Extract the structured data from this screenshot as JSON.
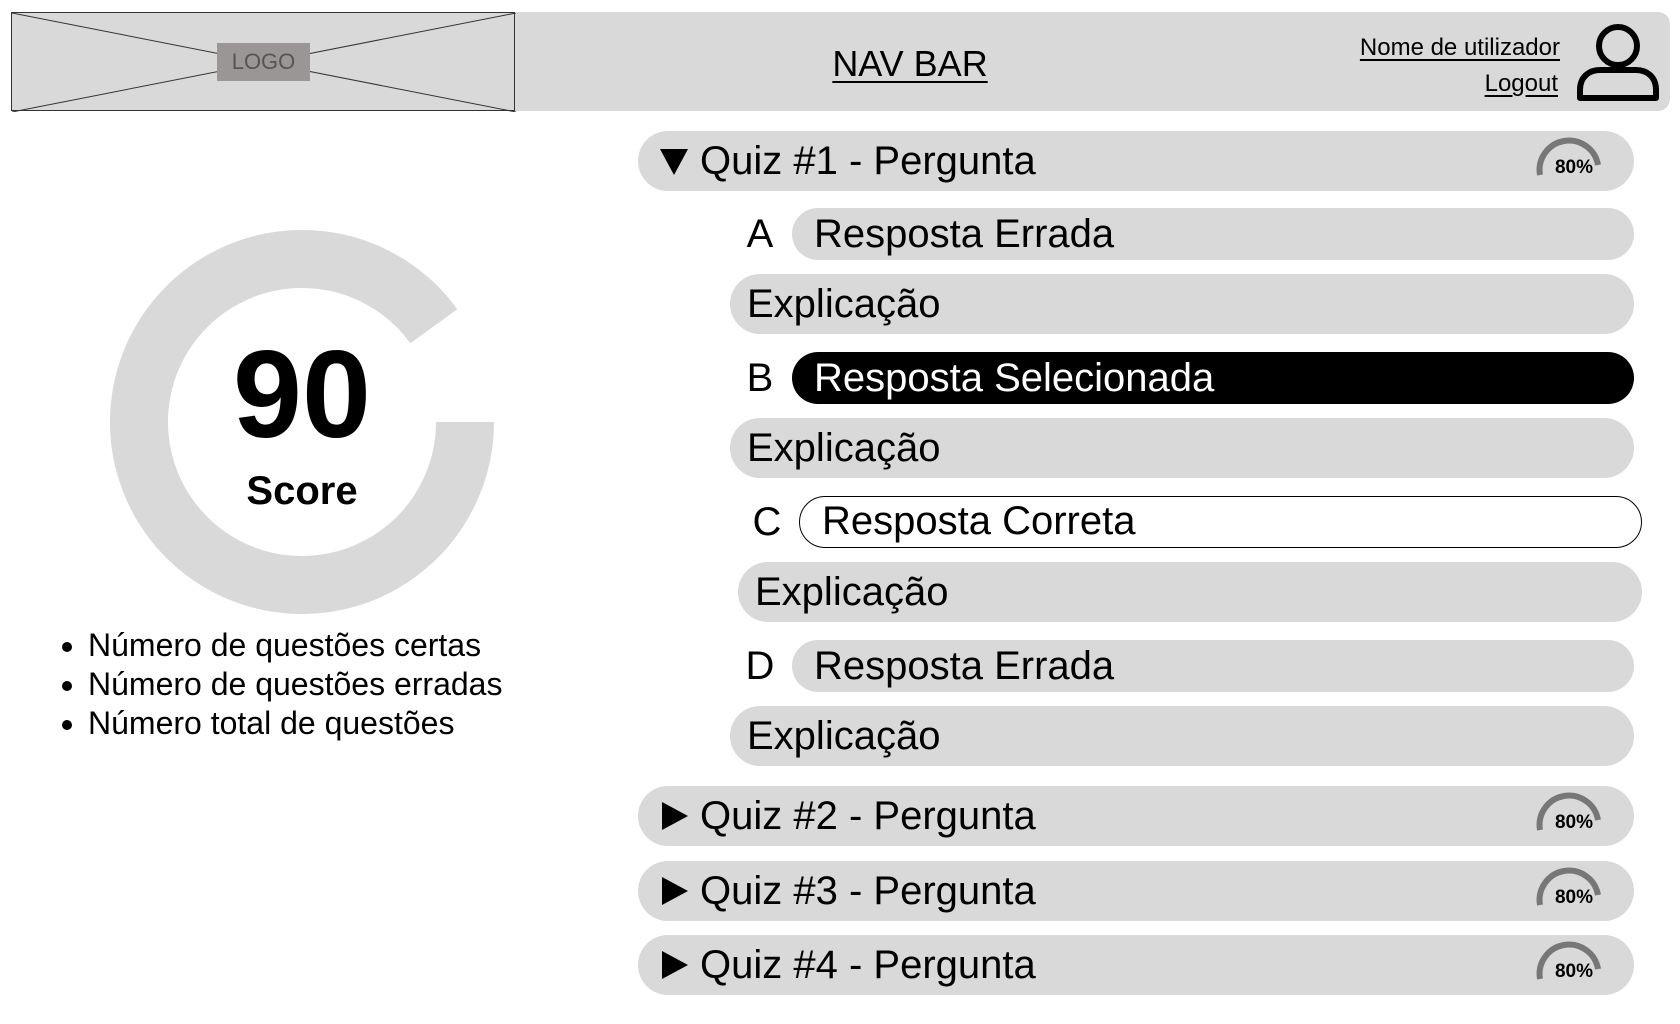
{
  "navbar": {
    "logo_label": "LOGO",
    "title": "NAV BAR",
    "user_name": "Nome de utilizador",
    "logout": "Logout",
    "avatar_icon": "user-icon"
  },
  "score": {
    "value": "90",
    "label": "Score",
    "ring_fill_fraction": 0.9
  },
  "stats": [
    "Número de questões certas",
    "Número de questões erradas",
    "Número total de questões"
  ],
  "quizzes": [
    {
      "title": "Quiz #1 - Pergunta",
      "expanded": true,
      "toggle_icon": "triangle-down-icon",
      "gauge_label": "80%",
      "gauge_value": 0.8,
      "answers": [
        {
          "letter": "A",
          "text": "Resposta Errada",
          "state": "wrong",
          "explanation": "Explicação"
        },
        {
          "letter": "B",
          "text": "Resposta Selecionada",
          "state": "selected",
          "explanation": "Explicação"
        },
        {
          "letter": "C",
          "text": "Resposta Correta",
          "state": "correct",
          "explanation": "Explicação"
        },
        {
          "letter": "D",
          "text": "Resposta Errada",
          "state": "wrong",
          "explanation": "Explicação"
        }
      ]
    },
    {
      "title": "Quiz #2 - Pergunta",
      "expanded": false,
      "toggle_icon": "triangle-right-icon",
      "gauge_label": "80%",
      "gauge_value": 0.8
    },
    {
      "title": "Quiz #3 - Pergunta",
      "expanded": false,
      "toggle_icon": "triangle-right-icon",
      "gauge_label": "80%",
      "gauge_value": 0.8
    },
    {
      "title": "Quiz #4 - Pergunta",
      "expanded": false,
      "toggle_icon": "triangle-right-icon",
      "gauge_label": "80%",
      "gauge_value": 0.8
    }
  ],
  "colors": {
    "panel_gray": "#d9d9d9",
    "logo_label_bg": "#9a9696",
    "selected_bg": "#000000",
    "selected_text": "#ffffff",
    "gauge_stroke": "#777777"
  }
}
